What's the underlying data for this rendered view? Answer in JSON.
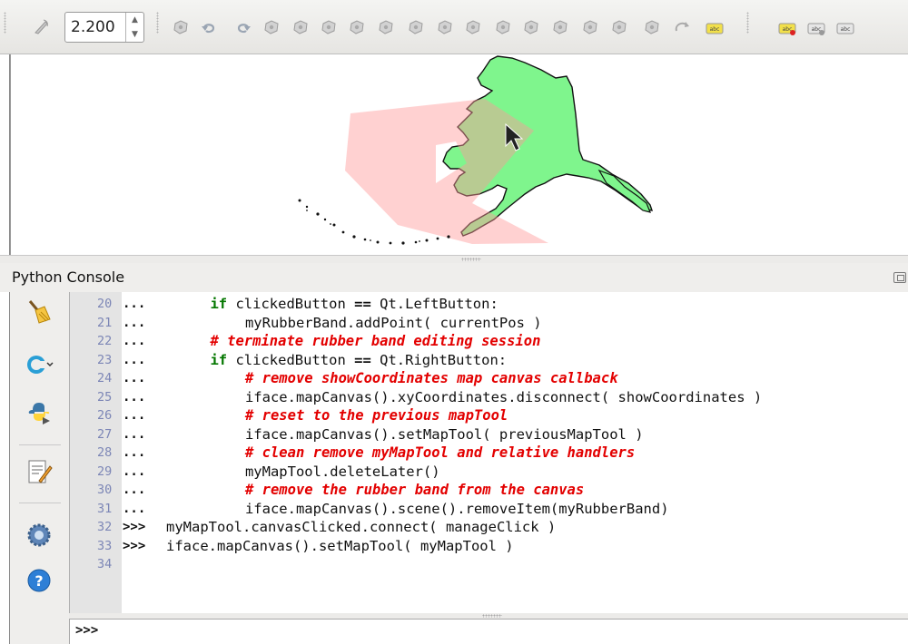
{
  "toolbar": {
    "scale_value": "2.200",
    "icons": [
      "pan-map-icon",
      "undo-icon",
      "redo-icon",
      "add-feature-icon",
      "move-feature-icon",
      "node-tool-icon",
      "simplify-icon",
      "add-ring-icon",
      "add-part-icon",
      "fill-ring-icon",
      "delete-ring-icon",
      "delete-part-icon",
      "reshape-icon",
      "offset-curve-icon",
      "split-features-icon",
      "split-parts-icon",
      "merge-features-icon",
      "rotate-icon",
      "label-icon",
      "pin-label-icon",
      "show-label-icon",
      "change-label-icon"
    ]
  },
  "console": {
    "title": "Python Console",
    "input_prompt": ">>>",
    "side_buttons": [
      "clear-console-icon",
      "import-class-icon",
      "run-command-icon",
      "show-editor-icon",
      "settings-icon",
      "help-icon"
    ],
    "lines": [
      {
        "n": "20",
        "p": "...",
        "indent": "    ",
        "parts": [
          {
            "t": "if",
            "c": "kw"
          },
          {
            "t": " clickedButton ",
            "c": ""
          },
          {
            "t": "==",
            "c": "op"
          },
          {
            "t": " Qt.LeftButton:",
            "c": ""
          }
        ]
      },
      {
        "n": "21",
        "p": "...",
        "indent": "        ",
        "parts": [
          {
            "t": "myRubberBand.addPoint( currentPos )",
            "c": ""
          }
        ]
      },
      {
        "n": "22",
        "p": "...",
        "indent": "    ",
        "parts": [
          {
            "t": "# terminate rubber band editing session",
            "c": "cm"
          }
        ]
      },
      {
        "n": "23",
        "p": "...",
        "indent": "    ",
        "parts": [
          {
            "t": "if",
            "c": "kw"
          },
          {
            "t": " clickedButton ",
            "c": ""
          },
          {
            "t": "==",
            "c": "op"
          },
          {
            "t": " Qt.RightButton:",
            "c": ""
          }
        ]
      },
      {
        "n": "24",
        "p": "...",
        "indent": "        ",
        "parts": [
          {
            "t": "# remove showCoordinates map canvas callback",
            "c": "cm"
          }
        ]
      },
      {
        "n": "25",
        "p": "...",
        "indent": "        ",
        "parts": [
          {
            "t": "iface.mapCanvas().xyCoordinates.disconnect( showCoordinates )",
            "c": ""
          }
        ]
      },
      {
        "n": "26",
        "p": "...",
        "indent": "        ",
        "parts": [
          {
            "t": "# reset to the previous mapTool",
            "c": "cm"
          }
        ]
      },
      {
        "n": "27",
        "p": "...",
        "indent": "        ",
        "parts": [
          {
            "t": "iface.mapCanvas().setMapTool( previousMapTool )",
            "c": ""
          }
        ]
      },
      {
        "n": "28",
        "p": "...",
        "indent": "        ",
        "parts": [
          {
            "t": "# clean remove myMapTool and relative handlers",
            "c": "cm"
          }
        ]
      },
      {
        "n": "29",
        "p": "...",
        "indent": "        ",
        "parts": [
          {
            "t": "myMapTool.deleteLater()",
            "c": ""
          }
        ]
      },
      {
        "n": "30",
        "p": "...",
        "indent": "        ",
        "parts": [
          {
            "t": "# remove the rubber band from the canvas",
            "c": "cm"
          }
        ]
      },
      {
        "n": "31",
        "p": "...",
        "indent": "        ",
        "parts": [
          {
            "t": "iface.mapCanvas().scene().removeItem(myRubberBand)",
            "c": ""
          }
        ]
      },
      {
        "n": "32",
        "p": ">>>",
        "indent": "",
        "parts": [
          {
            "t": "myMapTool.canvasClicked.connect( manageClick )",
            "c": ""
          }
        ]
      },
      {
        "n": "33",
        "p": ">>>",
        "indent": "",
        "parts": [
          {
            "t": "iface.mapCanvas().setMapTool( myMapTool )",
            "c": ""
          }
        ]
      },
      {
        "n": "34",
        "p": "",
        "indent": "",
        "parts": []
      }
    ]
  },
  "colors": {
    "land_fill": "#7ff58d",
    "rubber_band": "#ff9a9a",
    "keyword": "#047700",
    "comment": "#e30000",
    "line_number": "#7c86b6"
  }
}
